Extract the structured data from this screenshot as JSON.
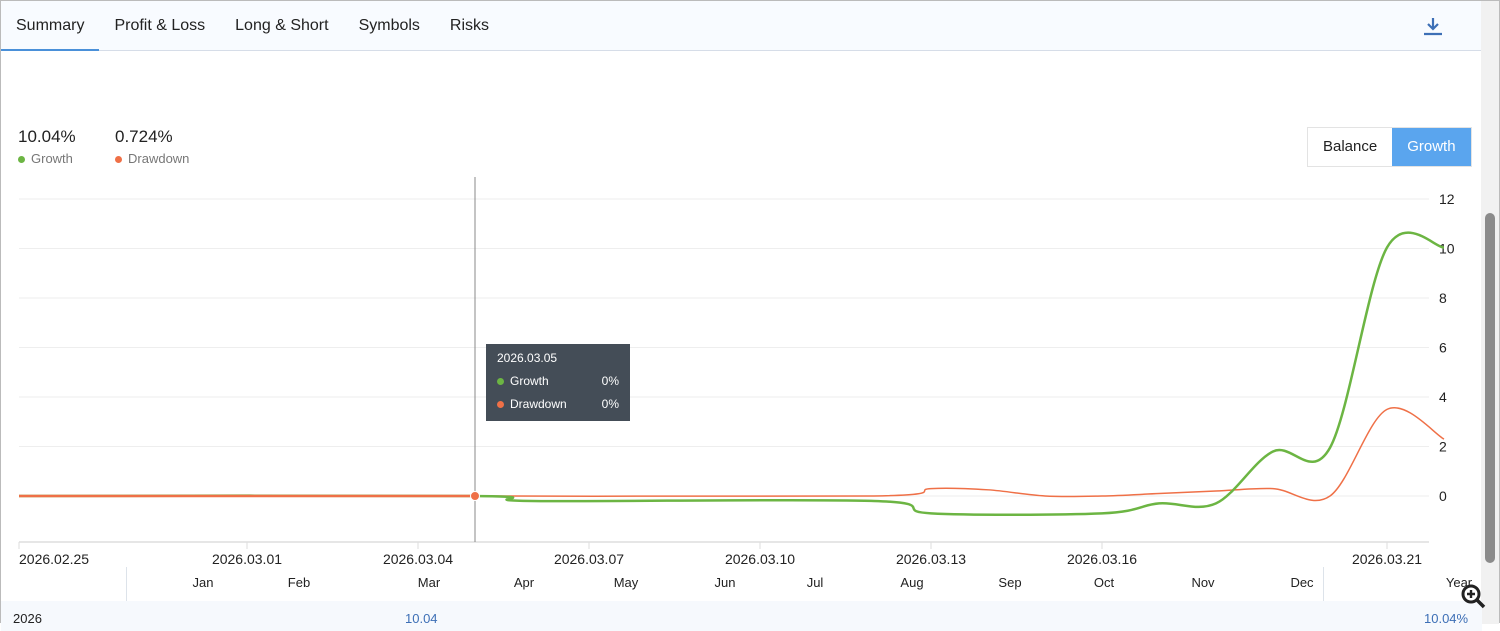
{
  "tabs": [
    "Summary",
    "Profit & Loss",
    "Long & Short",
    "Symbols",
    "Risks"
  ],
  "active_tab": "Summary",
  "stats": {
    "growth_value": "10.04%",
    "growth_label": "Growth",
    "drawdown_value": "0.724%",
    "drawdown_label": "Drawdown"
  },
  "toggle": {
    "balance": "Balance",
    "growth": "Growth",
    "selected": "Growth"
  },
  "colors": {
    "growth": "#6cb543",
    "drawdown": "#ef7047",
    "accent": "#5aa5ee"
  },
  "tooltip": {
    "date": "2026.03.05",
    "growth_label": "Growth",
    "growth_value": "0%",
    "drawdown_label": "Drawdown",
    "drawdown_value": "0%"
  },
  "chart_data": {
    "type": "line",
    "x_ticks": [
      "2026.02.25",
      "2026.03.01",
      "2026.03.04",
      "2026.03.07",
      "2026.03.10",
      "2026.03.13",
      "2026.03.16",
      "2026.03.21"
    ],
    "y_ticks": [
      "0",
      "2",
      "4",
      "6",
      "8",
      "10",
      "12"
    ],
    "ylim": [
      -2,
      12
    ],
    "grid": true,
    "series": [
      {
        "name": "Growth",
        "x": [
          "2026.02.25",
          "2026.03.05",
          "2026.03.06",
          "2026.03.12",
          "2026.03.13",
          "2026.03.16",
          "2026.03.17",
          "2026.03.18",
          "2026.03.19",
          "2026.03.20",
          "2026.03.21",
          "2026.03.22"
        ],
        "values": [
          0,
          0,
          -0.2,
          -0.2,
          -0.7,
          -0.7,
          -0.3,
          -0.3,
          1.8,
          1.95,
          10.04,
          10.04
        ]
      },
      {
        "name": "Drawdown",
        "x": [
          "2026.02.25",
          "2026.03.05",
          "2026.03.12",
          "2026.03.13",
          "2026.03.14",
          "2026.03.15",
          "2026.03.16",
          "2026.03.17",
          "2026.03.18",
          "2026.03.19",
          "2026.03.20",
          "2026.03.21",
          "2026.03.22"
        ],
        "values": [
          0,
          0,
          0,
          0.3,
          0.25,
          0,
          0,
          0.1,
          0.2,
          0.3,
          0,
          3.5,
          2.3
        ]
      }
    ]
  },
  "monthly": {
    "months": [
      "Jan",
      "Feb",
      "Mar",
      "Apr",
      "May",
      "Jun",
      "Jul",
      "Aug",
      "Sep",
      "Oct",
      "Nov",
      "Dec"
    ],
    "year_header": "Year",
    "year": "2026",
    "mar_value": "10.04",
    "year_value": "10.04%"
  }
}
